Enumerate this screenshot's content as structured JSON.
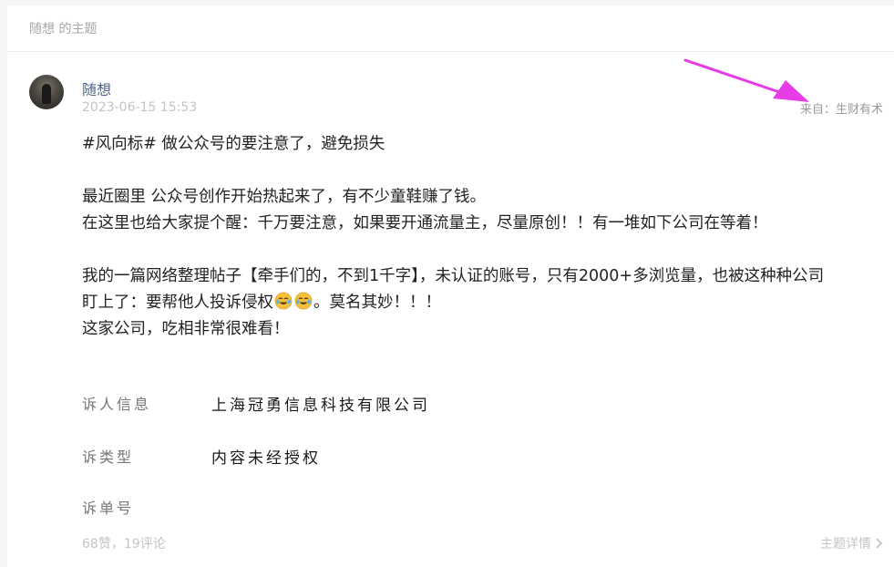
{
  "header": {
    "title": "随想 的主题"
  },
  "post": {
    "author": "随想",
    "timestamp": "2023-06-15 15:53",
    "source": "来自：生财有术",
    "headline": "#风向标# 做公众号的要注意了，避免损失",
    "para1_line1": "最近圈里 公众号创作开始热起来了，有不少童鞋赚了钱。",
    "para1_line2": "在这里也给大家提个醒：千万要注意，如果要开通流量主，尽量原创！！有一堆如下公司在等着！",
    "para2_line1": "我的一篇网络整理帖子【牵手们的，不到1千字】，未认证的账号，只有2000+多浏览量，也被这种种公司",
    "para2_line2_before": "盯上了：要帮他人投诉侵权",
    "para2_line2_after": "。莫名其妙！！！",
    "para2_line3": "这家公司，吃相非常很难看！",
    "complaint": {
      "row1_label": "诉人信息",
      "row1_value": "上海冠勇信息科技有限公司",
      "row2_label": "诉类型",
      "row2_value": "内容未经授权",
      "row3_label": "诉单号"
    },
    "stats": "68赞，19评论",
    "detail_link": "主题详情"
  },
  "colors": {
    "annotation_arrow": "#e63ce6",
    "author_link": "#50658a",
    "muted_text": "#c4c4c4"
  },
  "icons": {
    "emoji": "crying-laughing-emoji",
    "detail": "chevron-right-icon"
  }
}
